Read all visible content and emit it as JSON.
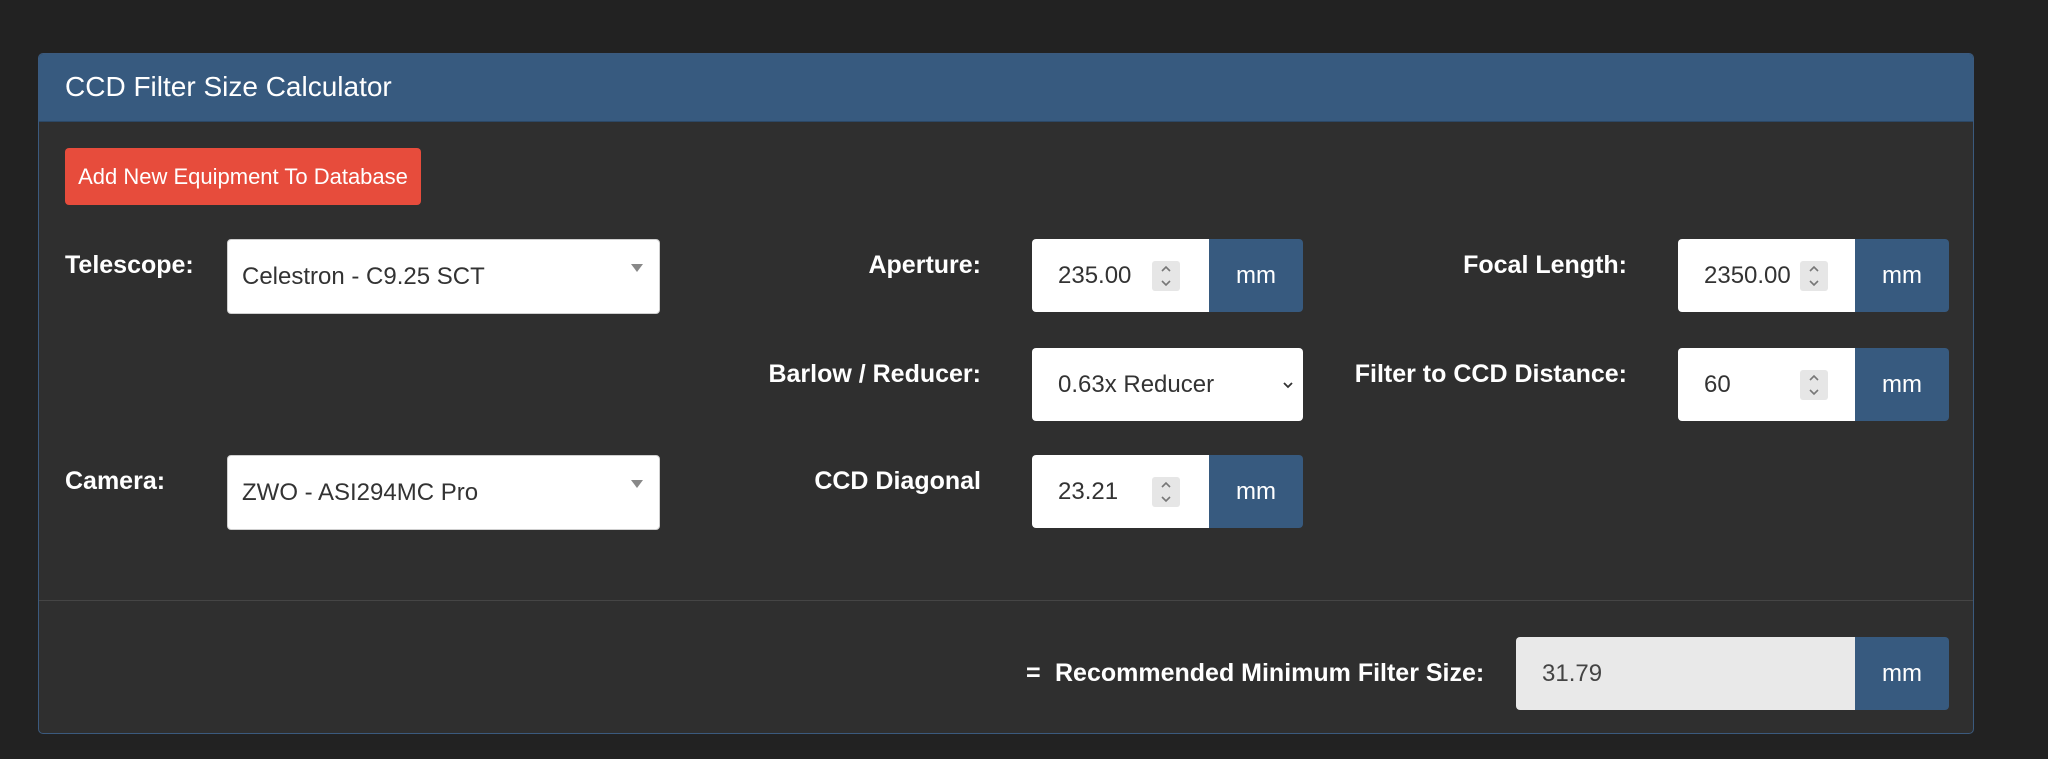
{
  "panel": {
    "title": "CCD Filter Size Calculator",
    "add_button_label": "Add New Equipment To Database"
  },
  "telescope": {
    "label": "Telescope:",
    "selected": "Celestron - C9.25 SCT"
  },
  "camera": {
    "label": "Camera:",
    "selected": "ZWO - ASI294MC Pro"
  },
  "aperture": {
    "label": "Aperture:",
    "value": "235.00",
    "unit": "mm"
  },
  "focal_length": {
    "label": "Focal Length:",
    "value": "2350.00",
    "unit": "mm"
  },
  "barlow": {
    "label": "Barlow / Reducer:",
    "selected": "0.63x Reducer"
  },
  "filter_distance": {
    "label": "Filter to CCD Distance:",
    "value": "60",
    "unit": "mm"
  },
  "ccd_diagonal": {
    "label": "CCD Diagonal",
    "value": "23.21",
    "unit": "mm"
  },
  "result": {
    "equals": "=",
    "label": "Recommended Minimum Filter Size:",
    "value": "31.79",
    "unit": "mm"
  },
  "colors": {
    "background": "#222222",
    "panel": "#2f2f2f",
    "primary": "#375a7f",
    "danger": "#e74c3c"
  }
}
